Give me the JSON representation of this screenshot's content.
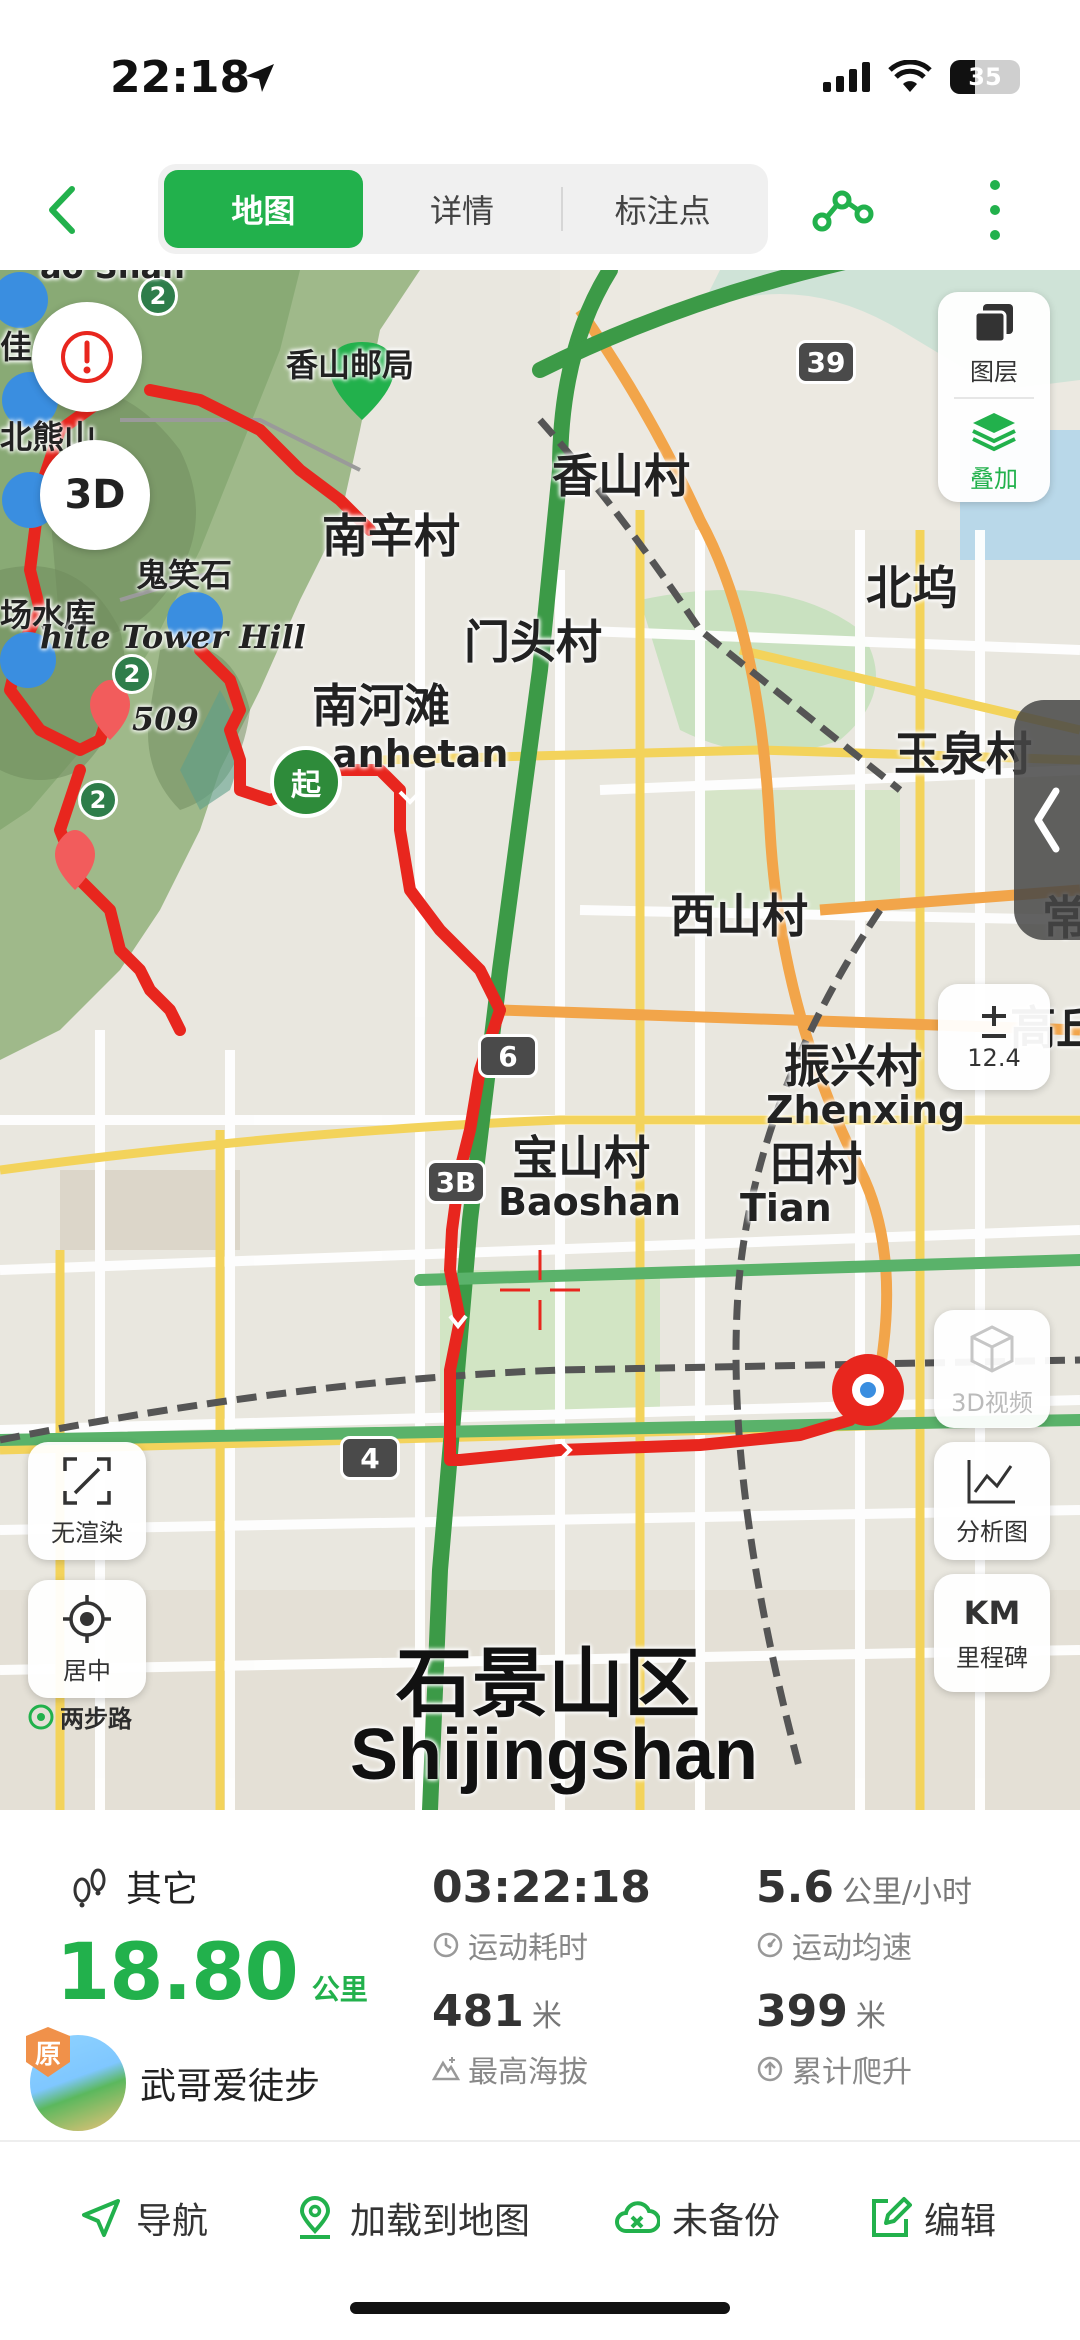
{
  "status_bar": {
    "time": "22:18",
    "battery": "35"
  },
  "nav": {
    "tabs": [
      {
        "label": "地图",
        "active": true
      },
      {
        "label": "详情",
        "active": false
      },
      {
        "label": "标注点",
        "active": false
      }
    ]
  },
  "map": {
    "labels": {
      "xiangshan_post": "香山邮局",
      "xiangshan_village": "香山村",
      "nanxin_village": "南辛村",
      "beiwu": "北坞",
      "menhou_village": "门头村",
      "guixiao_stone": "鬼笑石",
      "reservoir": "场水库",
      "white_tower_hill": "hite Tower Hill",
      "elevation": "509",
      "nanhetan": "南河滩",
      "nanhetan_en": "anhetan",
      "yuquan": "玉泉村",
      "xishan_village": "西山村",
      "chang": "常",
      "gaoqiu": "高丘",
      "zhenxing_village": "振兴村",
      "zhenxing_en": "Zhenxing",
      "baoshan_village": "宝山村",
      "baoshan_en": "Baoshan",
      "tian_village": "田村",
      "tian_en": "Tian",
      "bei_xiong": "北熊山",
      "district": "石景山区",
      "district_en": "Shijingshan",
      "partial_top": "ao Shan",
      "gui": "佳"
    },
    "road_shields": [
      "39",
      "6",
      "3B",
      "4"
    ],
    "start_marker": "起",
    "buttons": {
      "layers": "图层",
      "overlay": "叠加",
      "zoom_level": "12.4",
      "video_3d": "3D视频",
      "analysis": "分析图",
      "km_icon": "KM",
      "milestone": "里程碑",
      "no_render": "无渲染",
      "center": "居中",
      "mode_3d": "3D"
    },
    "marker_counts": [
      "2",
      "2",
      "2"
    ],
    "watermark": "两步路"
  },
  "stats": {
    "sport_type": "其它",
    "distance_value": "18.80",
    "distance_unit": "公里",
    "author": "武哥爱徒步",
    "original_badge": "原",
    "duration_value": "03:22:18",
    "duration_label": "运动耗时",
    "speed_value": "5.6",
    "speed_unit": "公里/小时",
    "speed_label": "运动均速",
    "max_alt_value": "481",
    "max_alt_unit": "米",
    "max_alt_label": "最高海拔",
    "climb_value": "399",
    "climb_unit": "米",
    "climb_label": "累计爬升"
  },
  "actions": {
    "navigate": "导航",
    "load_to_map": "加载到地图",
    "not_backed_up": "未备份",
    "edit": "编辑"
  },
  "colors": {
    "accent": "#22b14c",
    "route": "#e8261e",
    "start": "#2e8b3a"
  }
}
